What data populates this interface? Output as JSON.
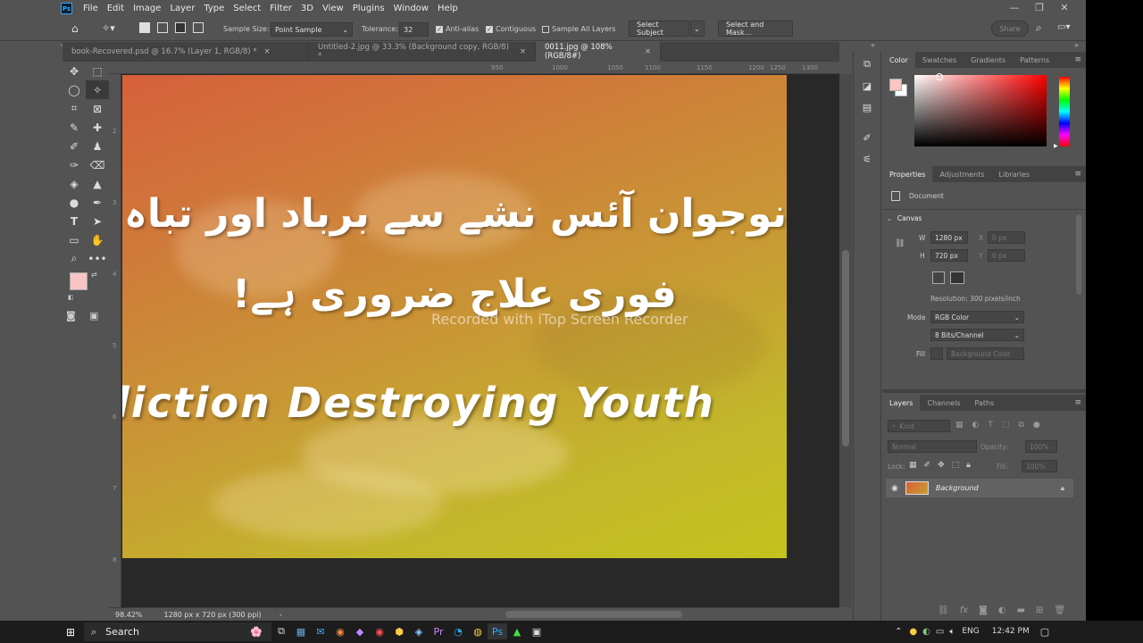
{
  "menubar": {
    "logo": "Ps",
    "items": [
      "File",
      "Edit",
      "Image",
      "Layer",
      "Type",
      "Select",
      "Filter",
      "3D",
      "View",
      "Plugins",
      "Window",
      "Help"
    ],
    "window_controls": [
      "—",
      "❐",
      "✕"
    ]
  },
  "options": {
    "sample_size_label": "Sample Size:",
    "sample_size_value": "Point Sample",
    "tolerance_label": "Tolerance:",
    "tolerance_value": "32",
    "anti_alias": "Anti-alias",
    "contiguous": "Contiguous",
    "sample_all_layers": "Sample All Layers",
    "select_subject": "Select Subject",
    "select_and_mask": "Select and Mask...",
    "share": "Share"
  },
  "tabs": [
    {
      "label": "book-Recovered.psd @ 16.7% (Layer 1, RGB/8) *",
      "active": false
    },
    {
      "label": "Untitled-2.jpg @ 33.3% (Background copy, RGB/8) *",
      "active": false
    },
    {
      "label": "0011.jpg @ 108% (RGB/8#)",
      "active": true
    }
  ],
  "ruler": {
    "top": [
      "950",
      "1000",
      "1050",
      "1100",
      "1150",
      "1200",
      "1250",
      "1300"
    ],
    "left": [
      "2",
      "3",
      "4",
      "5",
      "6",
      "7",
      "8"
    ]
  },
  "canvas": {
    "urdu_line1": "نوجوان آئس نشے سے برباد اور تباہ ہور",
    "urdu_line2": "فوری علاج ضروری ہے!",
    "english_title": "liction Destroying Youth",
    "watermark": "Recorded with iTop Screen Recorder"
  },
  "status": {
    "zoom": "98.42%",
    "doc_info": "1280 px x 720 px (300 ppi)"
  },
  "color_panel": {
    "tabs": [
      "Color",
      "Swatches",
      "Gradients",
      "Patterns"
    ],
    "foreground": "#f8c4c4",
    "background": "#ffffff",
    "picker_hue": "#ff0000"
  },
  "properties": {
    "tabs": [
      "Properties",
      "Adjustments",
      "Libraries"
    ],
    "document_label": "Document",
    "canvas_label": "Canvas",
    "w_label": "W",
    "w_value": "1280 px",
    "x_label": "X",
    "x_value": "0 px",
    "h_label": "H",
    "h_value": "720 px",
    "y_label": "Y",
    "y_value": "0 px",
    "resolution": "Resolution: 300 pixels/inch",
    "mode_label": "Mode",
    "mode_value": "RGB Color",
    "bits_value": "8 Bits/Channel",
    "fill_label": "Fill",
    "fill_value": "Background Color"
  },
  "layers": {
    "tabs": [
      "Layers",
      "Channels",
      "Paths"
    ],
    "kind": "Kind",
    "blend_mode": "Normal",
    "opacity_label": "Opacity:",
    "opacity_value": "100%",
    "lock_label": "Lock:",
    "fill_label": "Fill:",
    "fill_value": "100%",
    "layer_name": "Background"
  },
  "taskbar": {
    "search": "Search",
    "language": "ENG",
    "time": "12:42 PM"
  }
}
